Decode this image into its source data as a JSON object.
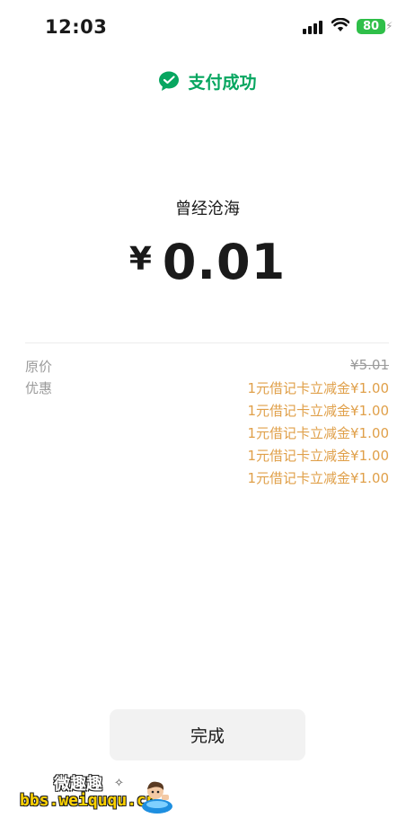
{
  "status_bar": {
    "time": "12:03",
    "battery": "80"
  },
  "header": {
    "title": "支付成功",
    "icon": "wechat-pay-icon",
    "accent": "#07a660"
  },
  "payment": {
    "merchant": "曾经沧海",
    "currency": "¥",
    "amount": "0.01"
  },
  "details": {
    "original_label": "原价",
    "original_price": "¥5.01",
    "discount_label": "优惠",
    "discounts": [
      "1元借记卡立减金¥1.00",
      "1元借记卡立减金¥1.00",
      "1元借记卡立减金¥1.00",
      "1元借记卡立减金¥1.00",
      "1元借记卡立减金¥1.00"
    ],
    "discount_color": "#e0a04a"
  },
  "actions": {
    "done_label": "完成"
  },
  "watermark": {
    "line1": "微趣趣",
    "line2": "bbs.weiququ.cn"
  }
}
